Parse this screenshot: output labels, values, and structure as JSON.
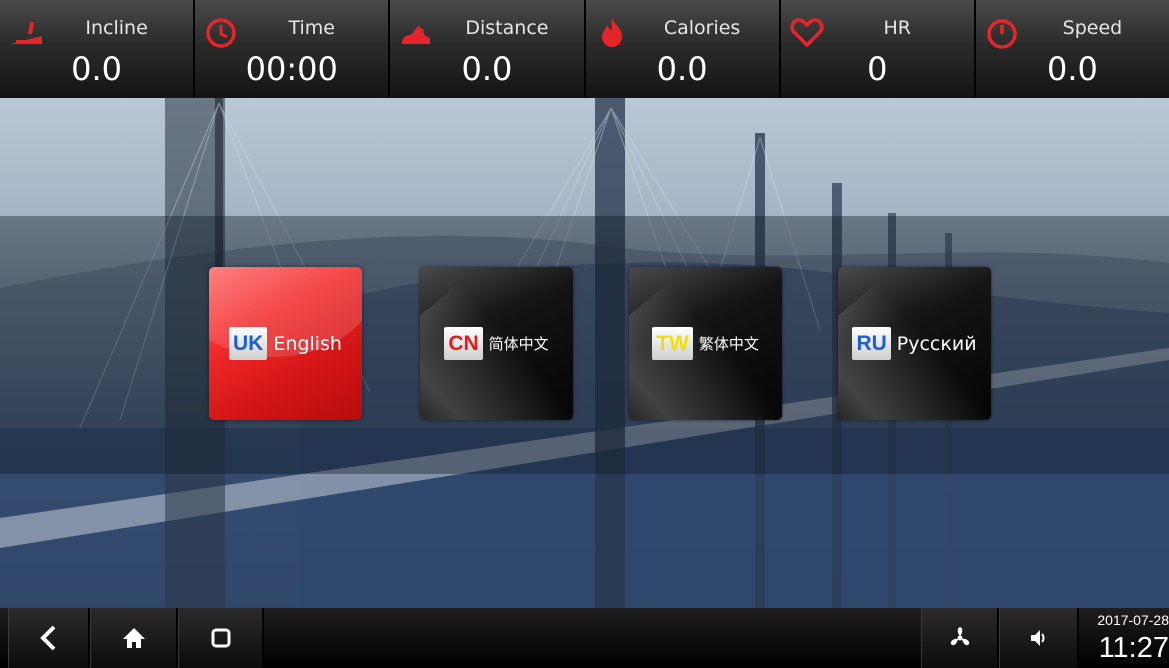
{
  "metrics": [
    {
      "label": "Incline",
      "value": "0.0",
      "icon": "incline-icon"
    },
    {
      "label": "Time",
      "value": "00:00",
      "icon": "clock-icon"
    },
    {
      "label": "Distance",
      "value": "0.0",
      "icon": "running-shoe-icon"
    },
    {
      "label": "Calories",
      "value": "0.0",
      "icon": "flame-icon"
    },
    {
      "label": "HR",
      "value": "0",
      "icon": "heart-icon"
    },
    {
      "label": "Speed",
      "value": "0.0",
      "icon": "speedometer-icon"
    }
  ],
  "languages": [
    {
      "code": "UK",
      "label": "English",
      "code_color": "#1a5fd6",
      "selected": true
    },
    {
      "code": "CN",
      "label": "简体中文",
      "code_color": "#e31b1b",
      "selected": false
    },
    {
      "code": "TW",
      "label": "繁体中文",
      "code_color": "#f0e000",
      "selected": false
    },
    {
      "code": "RU",
      "label": "Русский",
      "code_color": "#1a5fd6",
      "selected": false
    }
  ],
  "navbar": {
    "back_icon": "back-icon",
    "home_icon": "home-icon",
    "recents_icon": "recents-icon",
    "fan_icon": "fan-icon",
    "volume_icon": "volume-icon",
    "date": "2017-07-28",
    "time": "11:27"
  },
  "colors": {
    "accent_red": "#e02020",
    "metric_icon_red": "#e8242b"
  }
}
